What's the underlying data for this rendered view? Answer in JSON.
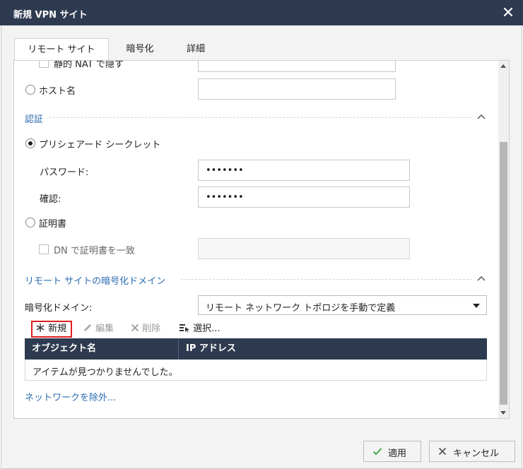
{
  "window": {
    "title": "新規 VPN サイト"
  },
  "tabs": [
    {
      "label": "リモート サイト"
    },
    {
      "label": "暗号化"
    },
    {
      "label": "詳細"
    }
  ],
  "top": {
    "static_nat_label": "静的 NAT で隠す",
    "hostname_label": "ホスト名"
  },
  "auth": {
    "section_title": "認証",
    "psk_label": "プリシェアード シークレット",
    "password_label": "パスワード:",
    "password_value": "•••••••",
    "confirm_label": "確認:",
    "confirm_value": "•••••••",
    "cert_label": "証明書",
    "dn_label": "DN で証明書を一致"
  },
  "domain": {
    "section_title": "リモート サイトの暗号化ドメイン",
    "domain_label": "暗号化ドメイン:",
    "domain_selected": "リモート ネットワーク トポロジを手動で定義",
    "toolbar": {
      "new_label": "新規",
      "edit_label": "編集",
      "delete_label": "削除",
      "select_label": "選択..."
    },
    "table": {
      "columns": [
        "オブジェクト名",
        "IP アドレス"
      ],
      "empty_text": "アイテムが見つかりませんでした。"
    },
    "exclude_link": "ネットワークを除外..."
  },
  "footer": {
    "apply_label": "適用",
    "cancel_label": "キャンセル"
  },
  "colors": {
    "titlebar": "#2e3a4f",
    "section_blue": "#2a6cb0",
    "highlight_red": "#e01f1f",
    "apply_check_green": "#3aa74a"
  }
}
